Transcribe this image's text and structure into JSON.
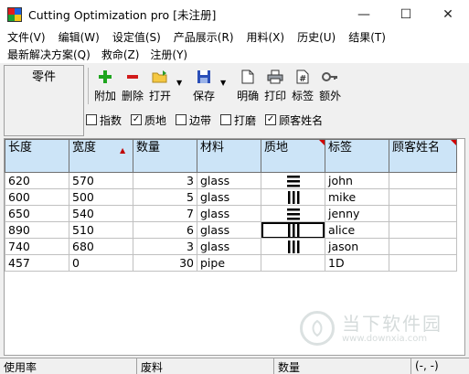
{
  "window": {
    "title": "Cutting Optimization pro [未注册]",
    "controls": {
      "minimize": "—",
      "maximize": "☐",
      "close": "✕"
    }
  },
  "menu": {
    "row1": [
      "文件(V)",
      "编辑(W)",
      "设定值(S)",
      "产品展示(R)",
      "用料(X)",
      "历史(U)",
      "结果(T)"
    ],
    "row2": [
      "最新解决方案(Q)",
      "救命(Z)",
      "注册(Y)"
    ]
  },
  "left_panel": {
    "title": "零件"
  },
  "toolbar": {
    "add": {
      "label": "附加",
      "icon": "plus-icon"
    },
    "delete": {
      "label": "删除",
      "icon": "minus-icon"
    },
    "open": {
      "label": "打开",
      "icon": "folder-icon"
    },
    "save": {
      "label": "保存",
      "icon": "floppy-icon"
    },
    "detail": {
      "label": "明确",
      "icon": "document-icon"
    },
    "print": {
      "label": "打印",
      "icon": "printer-icon"
    },
    "label": {
      "label": "标签",
      "icon": "hash-document-icon"
    },
    "extra": {
      "label": "额外",
      "icon": "key-icon"
    }
  },
  "checkboxes": [
    {
      "label": "指数",
      "checked": false
    },
    {
      "label": "质地",
      "checked": true
    },
    {
      "label": "边带",
      "checked": false
    },
    {
      "label": "打磨",
      "checked": false
    },
    {
      "label": "顾客姓名",
      "checked": true
    }
  ],
  "table": {
    "headers": [
      "长度",
      "宽度",
      "数量",
      "材料",
      "质地",
      "标签",
      "顾客姓名"
    ],
    "rows": [
      {
        "length": "620",
        "width": "570",
        "qty": "3",
        "material": "glass",
        "grain": "horizontal",
        "label": "john",
        "customer": ""
      },
      {
        "length": "600",
        "width": "500",
        "qty": "5",
        "material": "glass",
        "grain": "vertical",
        "label": "mike",
        "customer": ""
      },
      {
        "length": "650",
        "width": "540",
        "qty": "7",
        "material": "glass",
        "grain": "horizontal",
        "label": "jenny",
        "customer": ""
      },
      {
        "length": "890",
        "width": "510",
        "qty": "6",
        "material": "glass",
        "grain": "vertical",
        "label": "alice",
        "customer": ""
      },
      {
        "length": "740",
        "width": "680",
        "qty": "3",
        "material": "glass",
        "grain": "vertical",
        "label": "jason",
        "customer": ""
      },
      {
        "length": "457",
        "width": "0",
        "qty": "30",
        "material": "pipe",
        "grain": "none",
        "label": "1D",
        "customer": ""
      }
    ]
  },
  "statusbar": {
    "utilization": "使用率",
    "waste": "废料",
    "quantity": "数量",
    "coords": "(-, -)"
  },
  "watermark": {
    "text": "当下软件园",
    "url": "www.downxia.com"
  }
}
